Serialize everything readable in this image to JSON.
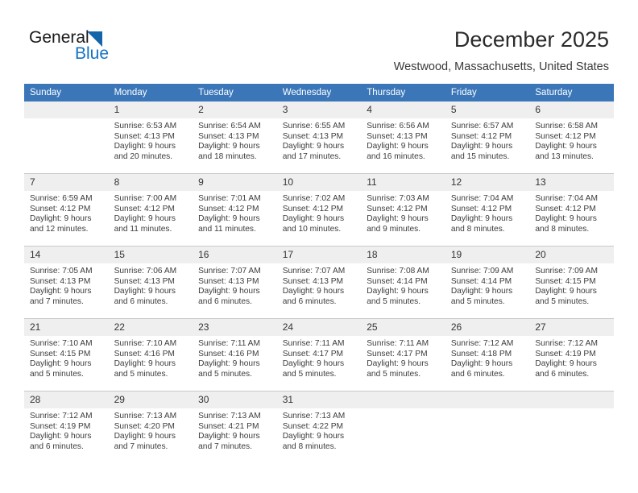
{
  "logo": {
    "word1": "General",
    "word2": "Blue",
    "triangle_icon": "triangle-icon",
    "accent_color": "#1472c4"
  },
  "header": {
    "title": "December 2025",
    "subtitle": "Westwood, Massachusetts, United States"
  },
  "calendar": {
    "header_bg": "#3a76b8",
    "daynum_bg": "#efefef",
    "weekdays": [
      "Sunday",
      "Monday",
      "Tuesday",
      "Wednesday",
      "Thursday",
      "Friday",
      "Saturday"
    ],
    "weeks": [
      [
        {
          "day": "",
          "sunrise": "",
          "sunset": "",
          "daylight1": "",
          "daylight2": ""
        },
        {
          "day": "1",
          "sunrise": "Sunrise: 6:53 AM",
          "sunset": "Sunset: 4:13 PM",
          "daylight1": "Daylight: 9 hours",
          "daylight2": "and 20 minutes."
        },
        {
          "day": "2",
          "sunrise": "Sunrise: 6:54 AM",
          "sunset": "Sunset: 4:13 PM",
          "daylight1": "Daylight: 9 hours",
          "daylight2": "and 18 minutes."
        },
        {
          "day": "3",
          "sunrise": "Sunrise: 6:55 AM",
          "sunset": "Sunset: 4:13 PM",
          "daylight1": "Daylight: 9 hours",
          "daylight2": "and 17 minutes."
        },
        {
          "day": "4",
          "sunrise": "Sunrise: 6:56 AM",
          "sunset": "Sunset: 4:13 PM",
          "daylight1": "Daylight: 9 hours",
          "daylight2": "and 16 minutes."
        },
        {
          "day": "5",
          "sunrise": "Sunrise: 6:57 AM",
          "sunset": "Sunset: 4:12 PM",
          "daylight1": "Daylight: 9 hours",
          "daylight2": "and 15 minutes."
        },
        {
          "day": "6",
          "sunrise": "Sunrise: 6:58 AM",
          "sunset": "Sunset: 4:12 PM",
          "daylight1": "Daylight: 9 hours",
          "daylight2": "and 13 minutes."
        }
      ],
      [
        {
          "day": "7",
          "sunrise": "Sunrise: 6:59 AM",
          "sunset": "Sunset: 4:12 PM",
          "daylight1": "Daylight: 9 hours",
          "daylight2": "and 12 minutes."
        },
        {
          "day": "8",
          "sunrise": "Sunrise: 7:00 AM",
          "sunset": "Sunset: 4:12 PM",
          "daylight1": "Daylight: 9 hours",
          "daylight2": "and 11 minutes."
        },
        {
          "day": "9",
          "sunrise": "Sunrise: 7:01 AM",
          "sunset": "Sunset: 4:12 PM",
          "daylight1": "Daylight: 9 hours",
          "daylight2": "and 11 minutes."
        },
        {
          "day": "10",
          "sunrise": "Sunrise: 7:02 AM",
          "sunset": "Sunset: 4:12 PM",
          "daylight1": "Daylight: 9 hours",
          "daylight2": "and 10 minutes."
        },
        {
          "day": "11",
          "sunrise": "Sunrise: 7:03 AM",
          "sunset": "Sunset: 4:12 PM",
          "daylight1": "Daylight: 9 hours",
          "daylight2": "and 9 minutes."
        },
        {
          "day": "12",
          "sunrise": "Sunrise: 7:04 AM",
          "sunset": "Sunset: 4:12 PM",
          "daylight1": "Daylight: 9 hours",
          "daylight2": "and 8 minutes."
        },
        {
          "day": "13",
          "sunrise": "Sunrise: 7:04 AM",
          "sunset": "Sunset: 4:12 PM",
          "daylight1": "Daylight: 9 hours",
          "daylight2": "and 8 minutes."
        }
      ],
      [
        {
          "day": "14",
          "sunrise": "Sunrise: 7:05 AM",
          "sunset": "Sunset: 4:13 PM",
          "daylight1": "Daylight: 9 hours",
          "daylight2": "and 7 minutes."
        },
        {
          "day": "15",
          "sunrise": "Sunrise: 7:06 AM",
          "sunset": "Sunset: 4:13 PM",
          "daylight1": "Daylight: 9 hours",
          "daylight2": "and 6 minutes."
        },
        {
          "day": "16",
          "sunrise": "Sunrise: 7:07 AM",
          "sunset": "Sunset: 4:13 PM",
          "daylight1": "Daylight: 9 hours",
          "daylight2": "and 6 minutes."
        },
        {
          "day": "17",
          "sunrise": "Sunrise: 7:07 AM",
          "sunset": "Sunset: 4:13 PM",
          "daylight1": "Daylight: 9 hours",
          "daylight2": "and 6 minutes."
        },
        {
          "day": "18",
          "sunrise": "Sunrise: 7:08 AM",
          "sunset": "Sunset: 4:14 PM",
          "daylight1": "Daylight: 9 hours",
          "daylight2": "and 5 minutes."
        },
        {
          "day": "19",
          "sunrise": "Sunrise: 7:09 AM",
          "sunset": "Sunset: 4:14 PM",
          "daylight1": "Daylight: 9 hours",
          "daylight2": "and 5 minutes."
        },
        {
          "day": "20",
          "sunrise": "Sunrise: 7:09 AM",
          "sunset": "Sunset: 4:15 PM",
          "daylight1": "Daylight: 9 hours",
          "daylight2": "and 5 minutes."
        }
      ],
      [
        {
          "day": "21",
          "sunrise": "Sunrise: 7:10 AM",
          "sunset": "Sunset: 4:15 PM",
          "daylight1": "Daylight: 9 hours",
          "daylight2": "and 5 minutes."
        },
        {
          "day": "22",
          "sunrise": "Sunrise: 7:10 AM",
          "sunset": "Sunset: 4:16 PM",
          "daylight1": "Daylight: 9 hours",
          "daylight2": "and 5 minutes."
        },
        {
          "day": "23",
          "sunrise": "Sunrise: 7:11 AM",
          "sunset": "Sunset: 4:16 PM",
          "daylight1": "Daylight: 9 hours",
          "daylight2": "and 5 minutes."
        },
        {
          "day": "24",
          "sunrise": "Sunrise: 7:11 AM",
          "sunset": "Sunset: 4:17 PM",
          "daylight1": "Daylight: 9 hours",
          "daylight2": "and 5 minutes."
        },
        {
          "day": "25",
          "sunrise": "Sunrise: 7:11 AM",
          "sunset": "Sunset: 4:17 PM",
          "daylight1": "Daylight: 9 hours",
          "daylight2": "and 5 minutes."
        },
        {
          "day": "26",
          "sunrise": "Sunrise: 7:12 AM",
          "sunset": "Sunset: 4:18 PM",
          "daylight1": "Daylight: 9 hours",
          "daylight2": "and 6 minutes."
        },
        {
          "day": "27",
          "sunrise": "Sunrise: 7:12 AM",
          "sunset": "Sunset: 4:19 PM",
          "daylight1": "Daylight: 9 hours",
          "daylight2": "and 6 minutes."
        }
      ],
      [
        {
          "day": "28",
          "sunrise": "Sunrise: 7:12 AM",
          "sunset": "Sunset: 4:19 PM",
          "daylight1": "Daylight: 9 hours",
          "daylight2": "and 6 minutes."
        },
        {
          "day": "29",
          "sunrise": "Sunrise: 7:13 AM",
          "sunset": "Sunset: 4:20 PM",
          "daylight1": "Daylight: 9 hours",
          "daylight2": "and 7 minutes."
        },
        {
          "day": "30",
          "sunrise": "Sunrise: 7:13 AM",
          "sunset": "Sunset: 4:21 PM",
          "daylight1": "Daylight: 9 hours",
          "daylight2": "and 7 minutes."
        },
        {
          "day": "31",
          "sunrise": "Sunrise: 7:13 AM",
          "sunset": "Sunset: 4:22 PM",
          "daylight1": "Daylight: 9 hours",
          "daylight2": "and 8 minutes."
        },
        {
          "day": "",
          "sunrise": "",
          "sunset": "",
          "daylight1": "",
          "daylight2": ""
        },
        {
          "day": "",
          "sunrise": "",
          "sunset": "",
          "daylight1": "",
          "daylight2": ""
        },
        {
          "day": "",
          "sunrise": "",
          "sunset": "",
          "daylight1": "",
          "daylight2": ""
        }
      ]
    ]
  }
}
